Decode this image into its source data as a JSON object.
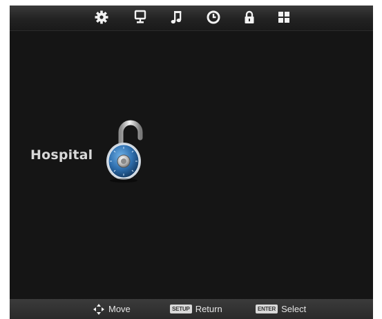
{
  "screen": {
    "tabs": [
      {
        "icon": "gear-icon",
        "label": ""
      },
      {
        "icon": "monitor-icon",
        "label": ""
      },
      {
        "icon": "music-note-icon",
        "label": ""
      },
      {
        "icon": "clock-icon",
        "label": ""
      },
      {
        "icon": "lock-icon",
        "label": ""
      },
      {
        "icon": "grid-icon",
        "label": ""
      }
    ],
    "active_tab_icon": "lock-icon",
    "menu": {
      "label": "Hospital",
      "icon": "padlock-icon"
    },
    "footer": {
      "move": {
        "icon": "directional-pad-icon",
        "label": "Move"
      },
      "return": {
        "key": "SETUP",
        "label": "Return"
      },
      "select": {
        "key": "ENTER",
        "label": "Select"
      }
    }
  },
  "colors": {
    "background": "#151515",
    "bar": "#2a2a2a",
    "lock_blue": "#2f6fae",
    "text": "#d8d8d8"
  }
}
